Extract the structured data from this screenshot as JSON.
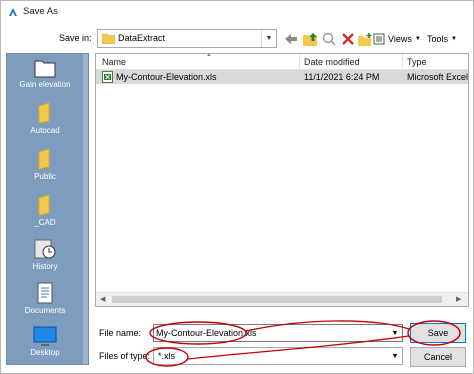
{
  "window": {
    "title": "Save As"
  },
  "toolbar": {
    "save_in_label": "Save in:",
    "save_in_value": "DataExtract",
    "views_label": "Views",
    "tools_label": "Tools",
    "icons": [
      "back-arrow-icon",
      "up-folder-icon",
      "search-web-icon",
      "delete-icon",
      "new-folder-icon"
    ]
  },
  "places": [
    {
      "label": "Gain elevation",
      "icon": "folder-icon"
    },
    {
      "label": "Autocad",
      "icon": "folder-icon"
    },
    {
      "label": "Public",
      "icon": "folder-icon"
    },
    {
      "label": "_CAD",
      "icon": "folder-icon"
    },
    {
      "label": "History",
      "icon": "history-icon"
    },
    {
      "label": "Documents",
      "icon": "documents-icon"
    },
    {
      "label": "Desktop",
      "icon": "desktop-icon"
    }
  ],
  "filelist": {
    "columns": [
      "Name",
      "Date modified",
      "Type"
    ],
    "rows": [
      {
        "name": "My-Contour-Elevation.xls",
        "date": "11/1/2021 6:24 PM",
        "type": "Microsoft Excel",
        "icon": "excel-file-icon"
      }
    ]
  },
  "form": {
    "file_name_label": "File name:",
    "file_name_value": "My-Contour-Elevation.xls",
    "file_type_label": "Files of type:",
    "file_type_value": "*.xls"
  },
  "buttons": {
    "save": "Save",
    "cancel": "Cancel"
  },
  "colors": {
    "places_bar": "#7e9cbd",
    "selection_row": "#d9d9d9",
    "annotation": "#c00000",
    "folder": "#f2c94c"
  }
}
